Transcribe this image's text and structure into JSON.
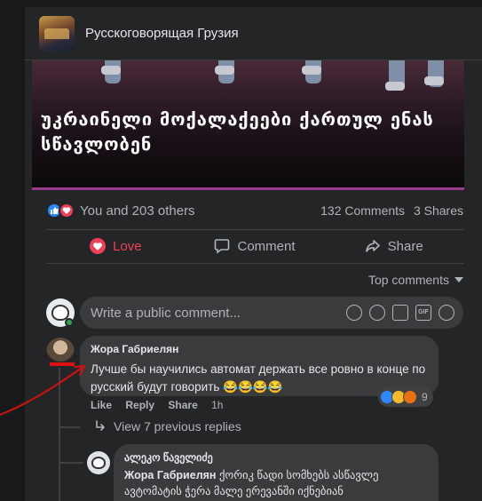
{
  "group": {
    "name": "Русскоговорящая Грузия"
  },
  "post": {
    "headline": "უკრაინელი მოქალაქეები ქართულ ენას სწავლობენ",
    "reactions_text": "You and 203 others",
    "comments_count": "132 Comments",
    "shares_count": "3 Shares"
  },
  "actions": {
    "love": "Love",
    "comment": "Comment",
    "share": "Share"
  },
  "sort": {
    "label": "Top comments"
  },
  "composer": {
    "placeholder": "Write a public comment...",
    "gif_label": "GIF"
  },
  "comment": {
    "author": "Жора Габриелян",
    "text": "Лучше бы научились автомат держать все ровно в конце по русский будут говорить 😂😂😂😂",
    "reaction_count": "9",
    "like": "Like",
    "reply": "Reply",
    "share": "Share",
    "time": "1h"
  },
  "replies": {
    "view_previous": "View 7 previous replies"
  },
  "reply": {
    "author": "ალეკო წაველიძე",
    "mention": "Жора Габриелян",
    "text": "ქორიკ წადი სომხებს ასწავლე ავტომატის ჭერა მალე ერევანში იქნებიან"
  },
  "colors": {
    "background": "#18191a",
    "card": "#242526",
    "bubble": "#3a3b3c",
    "love_red": "#f33e58",
    "like_blue": "#2d88ff",
    "accent_purple": "#9b3d8f",
    "annotation_red": "#d11111"
  }
}
